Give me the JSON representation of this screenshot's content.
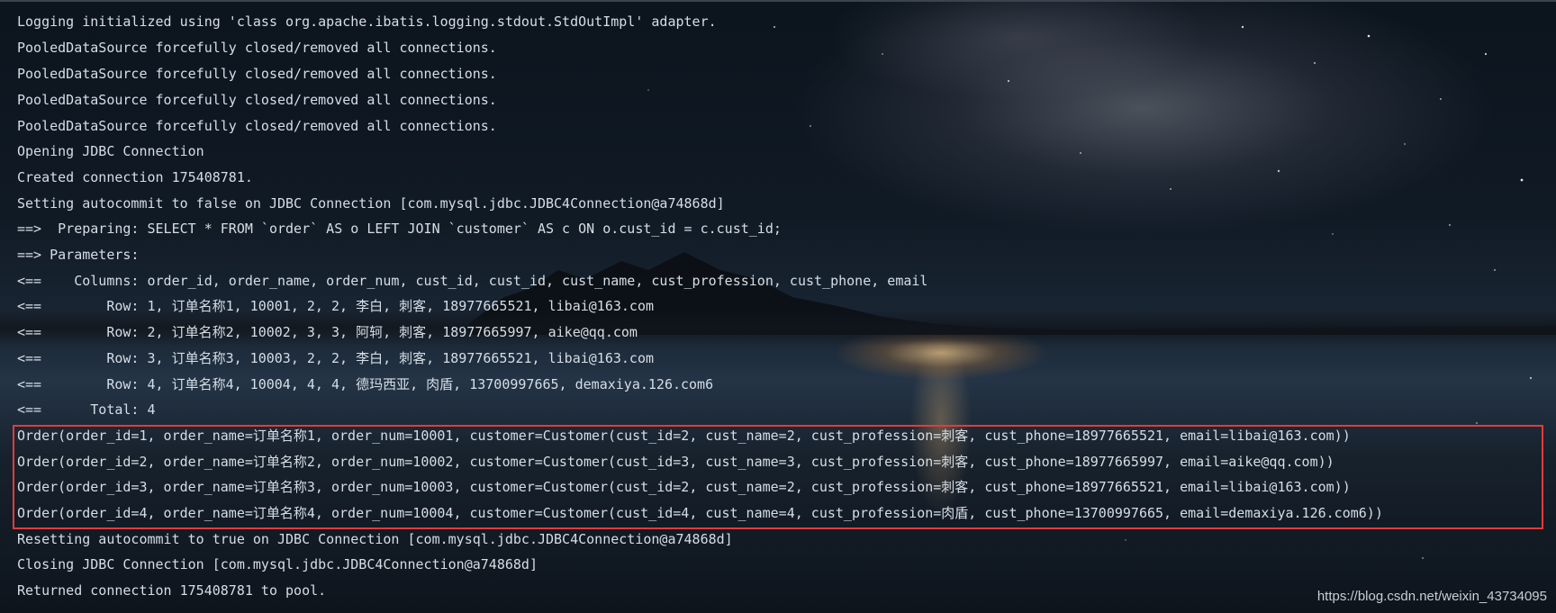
{
  "console": {
    "lines": [
      "Logging initialized using 'class org.apache.ibatis.logging.stdout.StdOutImpl' adapter.",
      "PooledDataSource forcefully closed/removed all connections.",
      "PooledDataSource forcefully closed/removed all connections.",
      "PooledDataSource forcefully closed/removed all connections.",
      "PooledDataSource forcefully closed/removed all connections.",
      "Opening JDBC Connection",
      "Created connection 175408781.",
      "Setting autocommit to false on JDBC Connection [com.mysql.jdbc.JDBC4Connection@a74868d]",
      "==>  Preparing: SELECT * FROM `order` AS o LEFT JOIN `customer` AS c ON o.cust_id = c.cust_id;",
      "==> Parameters: ",
      "<==    Columns: order_id, order_name, order_num, cust_id, cust_id, cust_name, cust_profession, cust_phone, email",
      "<==        Row: 1, 订单名称1, 10001, 2, 2, 李白, 刺客, 18977665521, libai@163.com",
      "<==        Row: 2, 订单名称2, 10002, 3, 3, 阿轲, 刺客, 18977665997, aike@qq.com",
      "<==        Row: 3, 订单名称3, 10003, 2, 2, 李白, 刺客, 18977665521, libai@163.com",
      "<==        Row: 4, 订单名称4, 10004, 4, 4, 德玛西亚, 肉盾, 13700997665, demaxiya.126.com6",
      "<==      Total: 4",
      "Order(order_id=1, order_name=订单名称1, order_num=10001, customer=Customer(cust_id=2, cust_name=2, cust_profession=刺客, cust_phone=18977665521, email=libai@163.com))",
      "Order(order_id=2, order_name=订单名称2, order_num=10002, customer=Customer(cust_id=3, cust_name=3, cust_profession=刺客, cust_phone=18977665997, email=aike@qq.com))",
      "Order(order_id=3, order_name=订单名称3, order_num=10003, customer=Customer(cust_id=2, cust_name=2, cust_profession=刺客, cust_phone=18977665521, email=libai@163.com))",
      "Order(order_id=4, order_name=订单名称4, order_num=10004, customer=Customer(cust_id=4, cust_name=4, cust_profession=肉盾, cust_phone=13700997665, email=demaxiya.126.com6))",
      "Resetting autocommit to true on JDBC Connection [com.mysql.jdbc.JDBC4Connection@a74868d]",
      "Closing JDBC Connection [com.mysql.jdbc.JDBC4Connection@a74868d]",
      "Returned connection 175408781 to pool."
    ]
  },
  "watermark": "https://blog.csdn.net/weixin_43734095",
  "colors": {
    "text": "#d6dde6",
    "highlight_border": "#e23b3b"
  }
}
